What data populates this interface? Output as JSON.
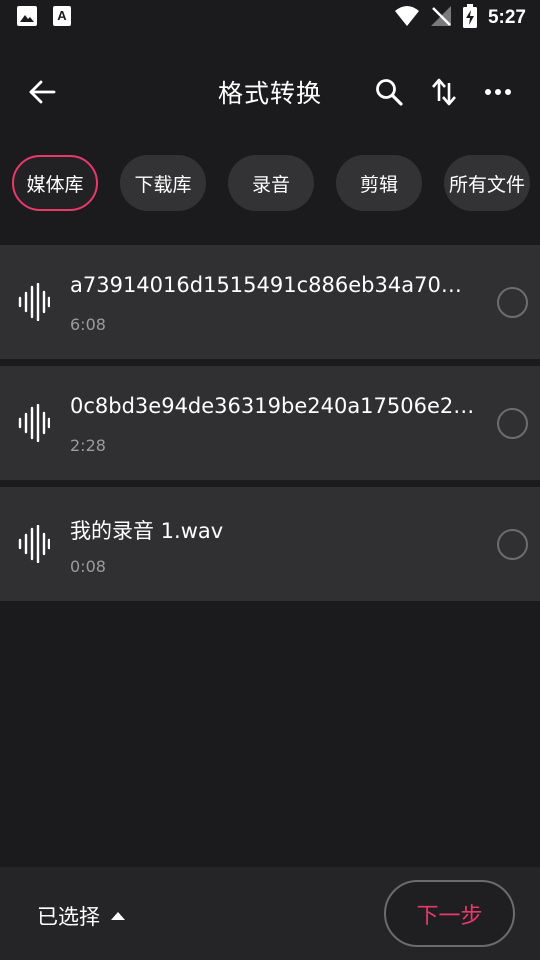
{
  "status_bar": {
    "time": "5:27",
    "icons": [
      "image-icon",
      "accessibility-a-icon",
      "wifi-icon",
      "no-signal-icon",
      "battery-charging-icon"
    ]
  },
  "toolbar": {
    "title": "格式转换",
    "icons": [
      "back-arrow-icon",
      "search-icon",
      "sort-arrows-icon",
      "more-dots-icon"
    ]
  },
  "chips": [
    {
      "label": "媒体库",
      "active": true
    },
    {
      "label": "下载库",
      "active": false
    },
    {
      "label": "录音",
      "active": false
    },
    {
      "label": "剪辑",
      "active": false
    },
    {
      "label": "所有文件",
      "active": false
    }
  ],
  "files": [
    {
      "name": "a73914016d1515491c886eb34a7045..",
      "duration": "6:08",
      "icon": "waveform-icon"
    },
    {
      "name": "0c8bd3e94de36319be240a17506e27..",
      "duration": "2:28",
      "icon": "waveform-icon"
    },
    {
      "name": "我的录音 1.wav",
      "duration": "0:08",
      "icon": "waveform-icon"
    }
  ],
  "bottom_bar": {
    "selected_label": "已选择",
    "next_label": "下一步"
  },
  "colors": {
    "background": "#1b1b1d",
    "row": "#303033",
    "chip": "#333336",
    "accent": "#e8396a",
    "secondary_text": "#9b9b9e"
  }
}
